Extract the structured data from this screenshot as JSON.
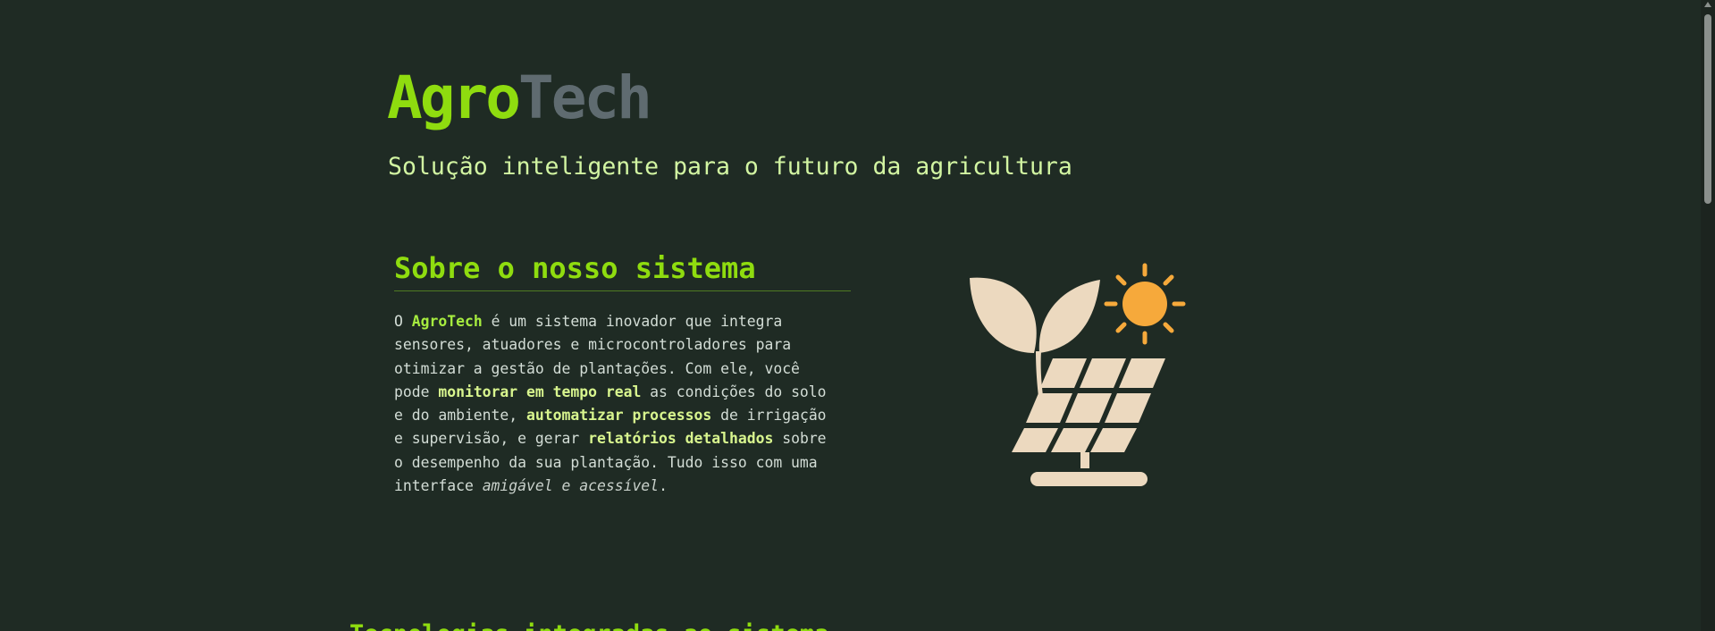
{
  "brand": {
    "part1": "Agro",
    "part2": "Tech"
  },
  "tagline": "Solução inteligente para o futuro da agricultura",
  "about": {
    "title": "Sobre o nosso sistema",
    "t0": "O ",
    "brand_word": "AgroTech",
    "t1": " é um sistema inovador que integra\nsensores, atuadores e microcontroladores para\notimizar a gestão de plantações. Com ele, você\npode ",
    "h1": "monitorar em tempo real",
    "t2": " as condições do solo\ne do ambiente, ",
    "h2": "automatizar processos",
    "t3": " de irrigação\ne supervisão, e gerar ",
    "h3": "relatórios detalhados",
    "t4": " sobre\no desempenho da sua plantação. Tudo isso com uma\ninterface ",
    "italic": "amigável e acessível",
    "t5": "."
  },
  "illustration": {
    "icon": "solar-plant-icon",
    "sun_color": "#f6a93b",
    "shape_color": "#ecd9bf"
  },
  "next_section": {
    "title": "Tecnologias integradas ao sistema"
  }
}
